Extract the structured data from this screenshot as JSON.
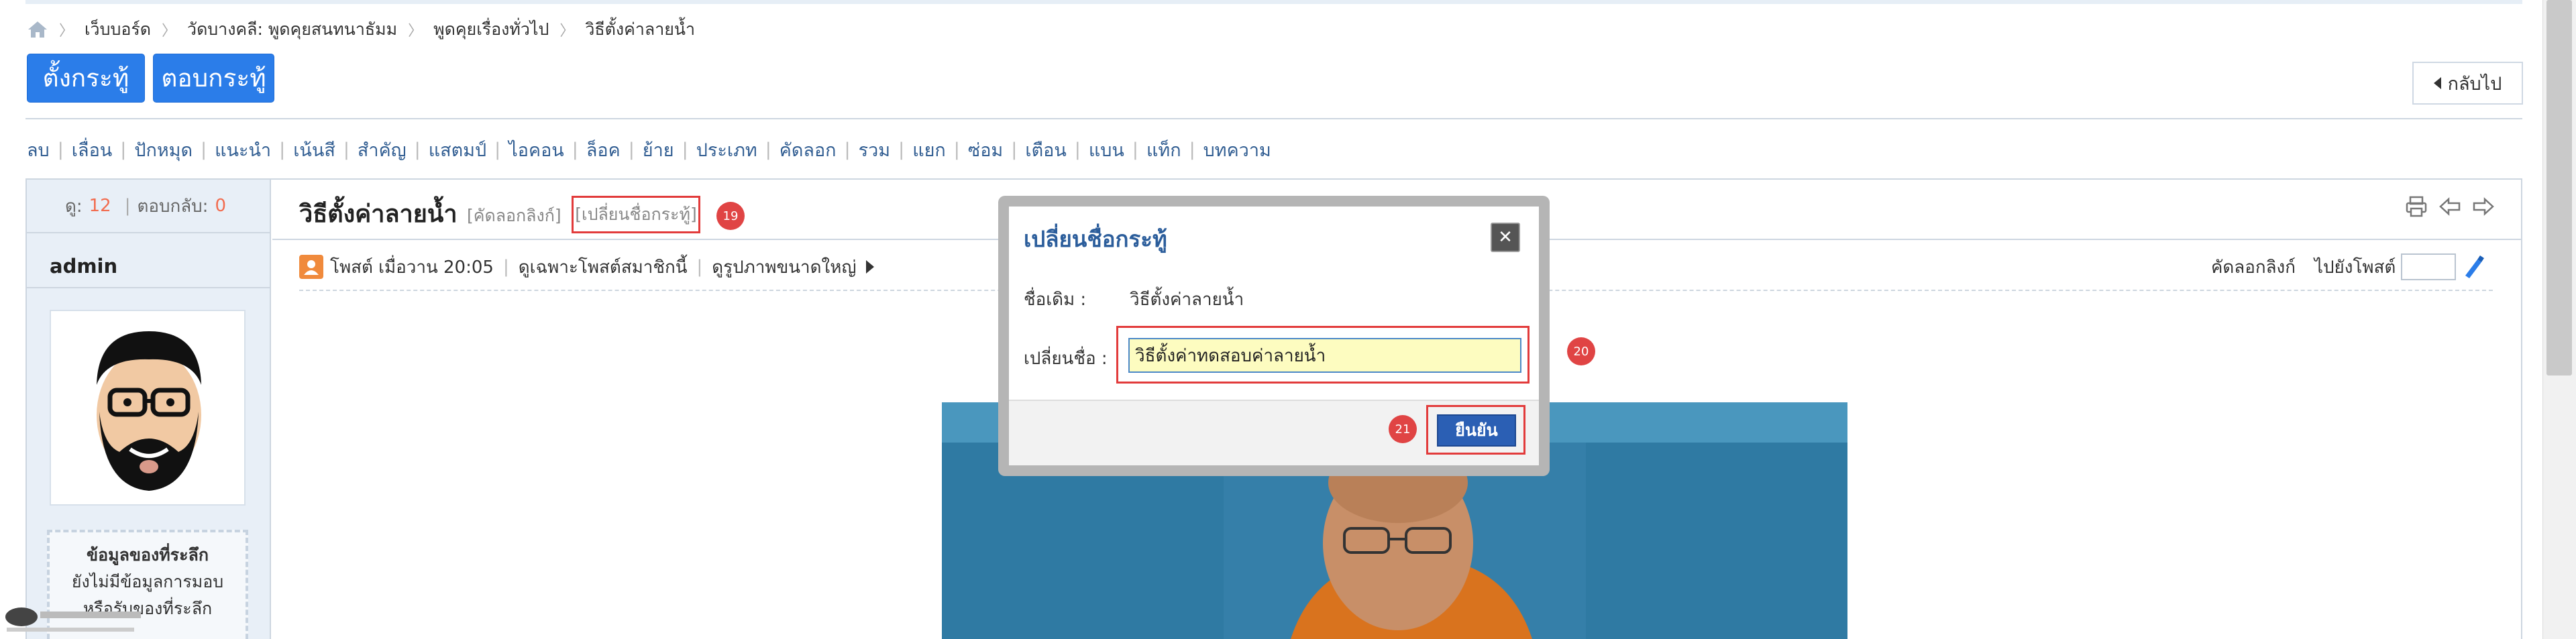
{
  "breadcrumb": {
    "items": [
      "เว็บบอร์ด",
      "วัดบางคลี: พูดคุยสนทนาธัมม",
      "พูดคุยเรื่องทั่วไป",
      "วิธีตั้งค่าลายน้ำ"
    ],
    "separator": "〉"
  },
  "toolbar": {
    "new_topic": "ตั้งกระทู้",
    "reply": "ตอบกระทู้",
    "back": "กลับไป"
  },
  "moderation": [
    "ลบ",
    "เลื่อน",
    "ปักหมุด",
    "แนะนำ",
    "เน้นสี",
    "สำคัญ",
    "แสตมป์",
    "ไอคอน",
    "ล็อค",
    "ย้าย",
    "ประเภท",
    "คัดลอก",
    "รวม",
    "แยก",
    "ซ่อม",
    "เตือน",
    "แบน",
    "แท็ก",
    "บทความ"
  ],
  "stats": {
    "views_label": "ดู:",
    "views": "12",
    "replies_label": "ตอบกลับ:",
    "replies": "0"
  },
  "author": {
    "name": "admin"
  },
  "medals": {
    "title": "ข้อมูลของที่ระลึก",
    "line1": "ยังไม่มีข้อมูลการมอบ",
    "line2": "หรือรับของที่ระลึก"
  },
  "thread": {
    "title": "วิธีตั้งค่าลายน้ำ",
    "copy_link": "[คัดลอกลิงก์]",
    "rename_link": "[เปลี่ยนชื่อกระทู้]"
  },
  "post_meta": {
    "posted": "โพสต์ เมื่อวาน 20:05",
    "only_author": "ดูเฉพาะโพสต์สมาชิกนี้",
    "large_image": "ดูรูปภาพขนาดใหญ่",
    "copy_link": "คัดลอกลิงก์",
    "goto_post": "ไปยังโพสต์"
  },
  "modal": {
    "title": "เปลี่ยนชื่อกระทู้",
    "old_label": "ชื่อเดิม :",
    "old_value": "วิธีตั้งค่าลายน้ำ",
    "new_label": "เปลี่ยนชื่อ :",
    "new_value": "วิธีตั้งค่าทดสอบค่าลายน้ำ",
    "confirm": "ยืนยัน",
    "close": "✕"
  },
  "annotations": {
    "a19": "19",
    "a20": "20",
    "a21": "21"
  },
  "colors": {
    "primary": "#2b7de9",
    "link": "#335f93",
    "annotation": "#e04444",
    "modal_title": "#2b5d9b"
  },
  "icons": [
    "home-icon",
    "print-icon",
    "prev-icon",
    "next-icon",
    "user-post-icon",
    "goto-icon"
  ]
}
